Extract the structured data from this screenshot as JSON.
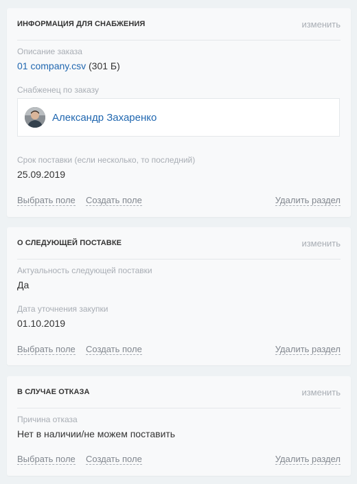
{
  "sections": [
    {
      "title": "ИНФОРМАЦИЯ ДЛЯ СНАБЖЕНИЯ",
      "edit_label": "изменить",
      "fields": [
        {
          "label": "Описание заказа",
          "file_name": "01 company.csv",
          "file_size": "(301 Б)"
        },
        {
          "label": "Снабженец по заказу",
          "user_name": "Александр Захаренко"
        },
        {
          "label": "Срок поставки (если несколько, то последний)",
          "value": "25.09.2019"
        }
      ],
      "footer": {
        "select_field": "Выбрать поле",
        "create_field": "Создать поле",
        "delete_section": "Удалить раздел"
      }
    },
    {
      "title": "О СЛЕДУЮЩЕЙ ПОСТАВКЕ",
      "edit_label": "изменить",
      "fields": [
        {
          "label": "Актуальность следующей поставки",
          "value": "Да"
        },
        {
          "label": "Дата уточнения закупки",
          "value": "01.10.2019"
        }
      ],
      "footer": {
        "select_field": "Выбрать поле",
        "create_field": "Создать поле",
        "delete_section": "Удалить раздел"
      }
    },
    {
      "title": "В СЛУЧАЕ ОТКАЗА",
      "edit_label": "изменить",
      "fields": [
        {
          "label": "Причина отказа",
          "value": "Нет в наличии/не можем поставить"
        }
      ],
      "footer": {
        "select_field": "Выбрать поле",
        "create_field": "Создать поле",
        "delete_section": "Удалить раздел"
      }
    }
  ],
  "colors": {
    "link": "#2067b0",
    "label": "#a8adb4",
    "text": "#333333",
    "background": "#eef2f4",
    "card": "#f8f9fa"
  },
  "icons": {
    "avatar": "user-avatar-photo"
  }
}
